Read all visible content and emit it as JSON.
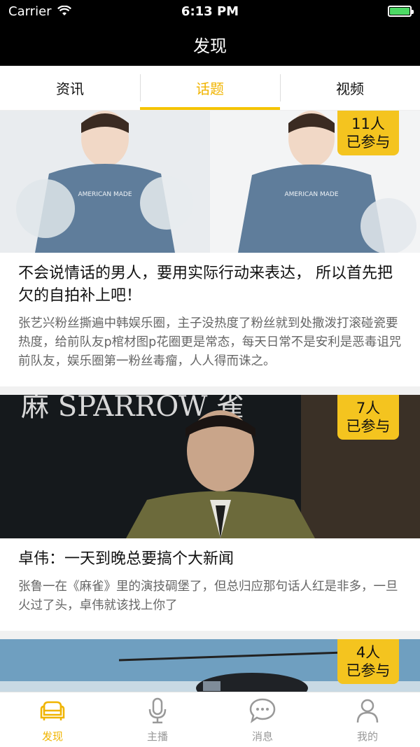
{
  "status_bar": {
    "carrier": "Carrier",
    "time": "6:13 PM",
    "battery_color": "#4cd964"
  },
  "navbar": {
    "title": "发现"
  },
  "tabs": [
    {
      "label": "资讯",
      "active": false
    },
    {
      "label": "话题",
      "active": true
    },
    {
      "label": "视频",
      "active": false
    }
  ],
  "accent_color": "#f5c400",
  "cards": [
    {
      "badge_count": "11人",
      "badge_suffix": "已参与",
      "title": "不会说情话的男人，要用实际行动来表达， 所以首先把欠的自拍补上吧！",
      "description": "张艺兴粉丝撕遍中韩娱乐圈，主子没热度了粉丝就到处撒泼打滚碰瓷要热度，给前队友p棺材图p花圈更是常态，每天日常不是安利是恶毒诅咒前队友，娱乐圈第一粉丝毒瘤，人人得而诛之。",
      "image_text": "AMERICAN MADE"
    },
    {
      "badge_count": "7人",
      "badge_suffix": "已参与",
      "title": "卓伟：一天到晚总要搞个大新闻",
      "description": "张鲁一在《麻雀》里的演技碉堡了，但总归应那句话人红是非多，一旦火过了头，卓伟就该找上你了",
      "image_text": "麻 SPARROW 雀"
    },
    {
      "badge_count": "4人",
      "badge_suffix": "已参与"
    }
  ],
  "tabbar": [
    {
      "label": "发现",
      "icon": "sofa-icon",
      "active": true
    },
    {
      "label": "主播",
      "icon": "microphone-icon",
      "active": false
    },
    {
      "label": "消息",
      "icon": "chat-bubble-icon",
      "active": false
    },
    {
      "label": "我的",
      "icon": "person-icon",
      "active": false
    }
  ]
}
